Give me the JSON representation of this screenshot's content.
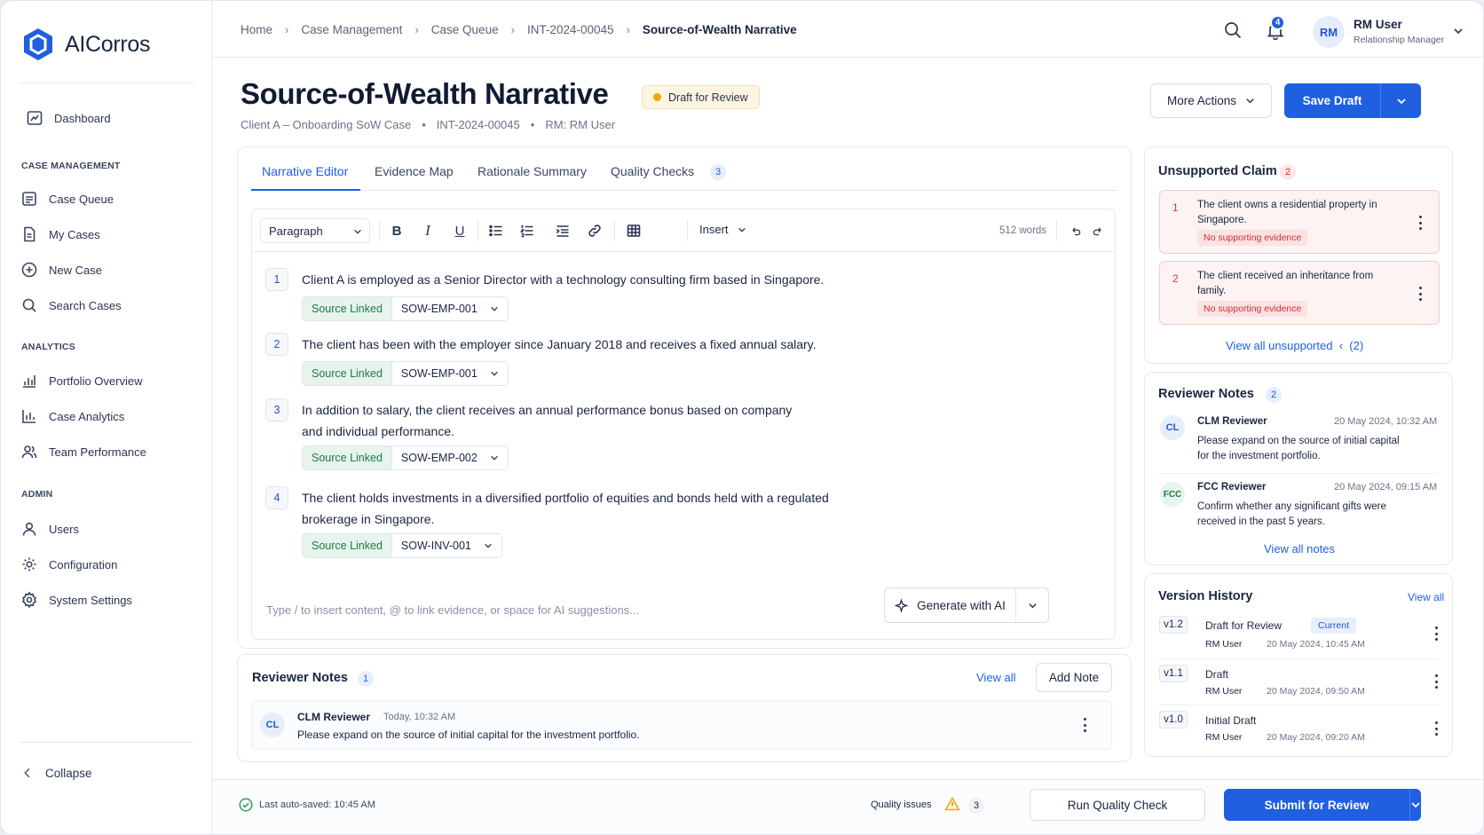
{
  "app": {
    "name": "AICorros"
  },
  "sidebar": {
    "dashboard": "Dashboard",
    "sections": {
      "case_management": "CASE MANAGEMENT",
      "analytics": "ANALYTICS",
      "admin": "ADMIN"
    },
    "case_items": [
      "Case Queue",
      "My Cases",
      "New Case",
      "Search Cases"
    ],
    "analytics_items": [
      "Portfolio Overview",
      "Case Analytics",
      "Team Performance"
    ],
    "admin_items": [
      "Users",
      "Configuration",
      "System Settings"
    ],
    "collapse": "Collapse"
  },
  "breadcrumb": [
    "Home",
    "Case Management",
    "Case Queue",
    "INT-2024-00045",
    "Source-of-Wealth Narrative"
  ],
  "topbar": {
    "notification_count": "4",
    "user_initials": "RM",
    "user_name": "RM User",
    "user_role": "Relationship Manager"
  },
  "header": {
    "title": "Source-of-Wealth Narrative",
    "status": "Draft for Review",
    "sub": [
      "Client A – Onboarding SoW Case",
      "•",
      "INT-2024-00045",
      "•",
      "RM: RM User"
    ],
    "more_actions": "More Actions",
    "save_draft": "Save Draft"
  },
  "tabs": [
    "Narrative Editor",
    "Evidence Map",
    "Rationale Summary",
    "Quality Checks"
  ],
  "tabs_quality_count": "3",
  "toolbar": {
    "format": "Paragraph",
    "insert": "Insert",
    "word_count": "512 words"
  },
  "narrative": [
    {
      "no": "1",
      "lines": [
        "Client A is employed as a Senior Director with a technology consulting firm based in Singapore."
      ],
      "source_status": "Source Linked",
      "source_id": "SOW-EMP-001"
    },
    {
      "no": "2",
      "lines": [
        "The client has been with the employer since January 2018 and receives a fixed annual salary."
      ],
      "source_status": "Source Linked",
      "source_id": "SOW-EMP-001"
    },
    {
      "no": "3",
      "lines": [
        "In addition to salary, the client receives an annual performance bonus based on company",
        "and individual performance."
      ],
      "source_status": "Source Linked",
      "source_id": "SOW-EMP-002"
    },
    {
      "no": "4",
      "lines": [
        "The client holds investments in a diversified portfolio of equities and bonds held with a regulated",
        "brokerage in Singapore."
      ],
      "source_status": "Source Linked",
      "source_id": "SOW-INV-001"
    }
  ],
  "editor": {
    "placeholder": "Type / to insert content, @ to link evidence, or space for AI suggestions...",
    "generate": "Generate with AI"
  },
  "bottom_notes": {
    "title": "Reviewer Notes",
    "count": "1",
    "view_all": "View all",
    "add_note": "Add Note",
    "note": {
      "initials": "CL",
      "author": "CLM Reviewer",
      "time": "Today, 10:32 AM",
      "text": "Please expand on the source of initial capital for the investment portfolio."
    }
  },
  "unsupported": {
    "title": "Unsupported Claim",
    "count": "2",
    "claims": [
      {
        "no": "1",
        "text": "The client owns a residential property in Singapore.",
        "badge": "No supporting evidence"
      },
      {
        "no": "2",
        "text": "The client received an inheritance from family.",
        "badge": "No supporting evidence"
      }
    ],
    "view_all": "View all unsupported",
    "view_all_count": "(2)"
  },
  "reviewer_notes": {
    "title": "Reviewer Notes",
    "count": "2",
    "notes": [
      {
        "initials": "CL",
        "author": "CLM Reviewer",
        "time": "20 May 2024, 10:32 AM",
        "text": "Please expand on the source of initial capital for the investment portfolio."
      },
      {
        "initials": "FCC",
        "author": "FCC Reviewer",
        "time": "20 May 2024, 09:15 AM",
        "text": "Confirm whether any significant gifts were received in the past 5 years."
      }
    ],
    "view_all": "View all notes"
  },
  "versions": {
    "title": "Version History",
    "view_all": "View all",
    "items": [
      {
        "v": "v1.2",
        "name": "Draft for Review",
        "tag": "Current",
        "user": "RM User",
        "time": "20 May 2024, 10:45 AM"
      },
      {
        "v": "v1.1",
        "name": "Draft",
        "tag": "",
        "user": "RM User",
        "time": "20 May 2024, 09:50 AM"
      },
      {
        "v": "v1.0",
        "name": "Initial Draft",
        "tag": "",
        "user": "RM User",
        "time": "20 May 2024, 09:20 AM"
      }
    ]
  },
  "footer": {
    "autosave": "Last auto-saved: 10:45 AM",
    "quality_issues": "Quality issues",
    "quality_count": "3",
    "run_check": "Run Quality Check",
    "submit": "Submit for Review"
  },
  "colors": {
    "accent": "#1f5fe0",
    "success": "#1e7a46",
    "warning": "#f0a800",
    "danger": "#d03030"
  }
}
